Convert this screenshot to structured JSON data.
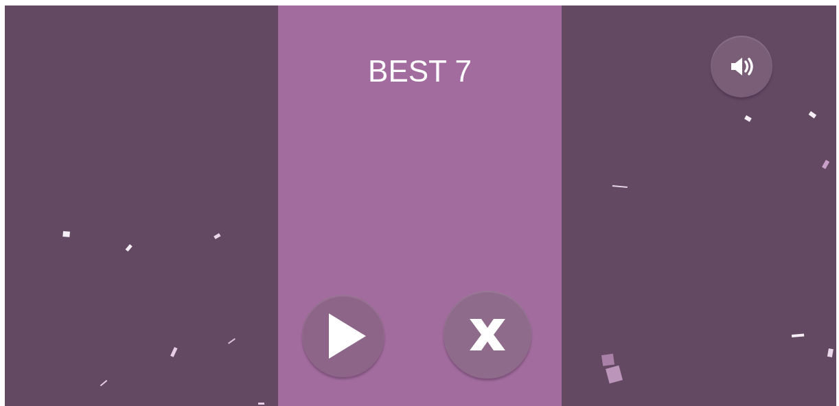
{
  "best": {
    "label": "BEST 7"
  },
  "buttons": [
    {
      "kind": "play"
    },
    {
      "kind": "close"
    }
  ],
  "sound": {
    "on": true
  }
}
